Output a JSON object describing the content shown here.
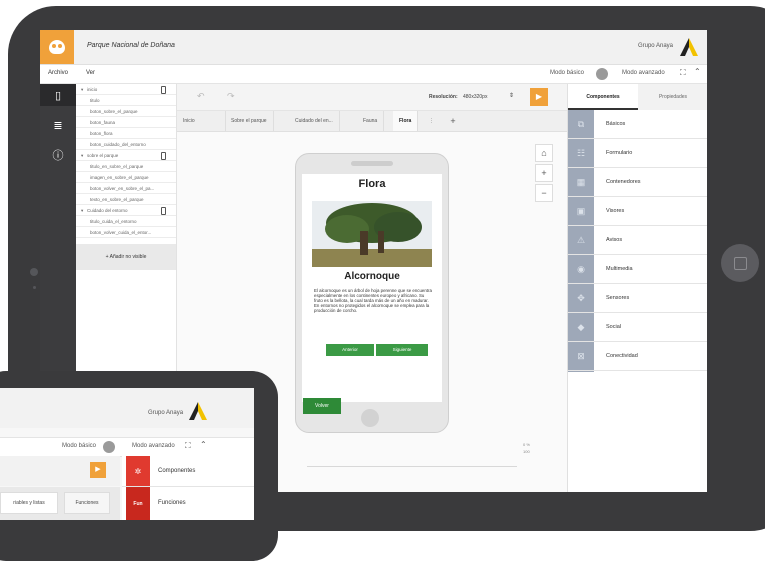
{
  "app": {
    "project_title": "Parque Nacional de Doñana",
    "brand": "Grupo Anaya",
    "brand_color": "#f0a13a"
  },
  "menu": {
    "archivo": "Archivo",
    "ver": "Ver",
    "mode_basic": "Modo básico",
    "mode_advanced": "Modo avanzado"
  },
  "left_nav": {
    "icons": [
      "phone-icon",
      "list-icon",
      "info-icon"
    ]
  },
  "tree": {
    "items": [
      "inicio",
      "titulo",
      "boton_sobre_el_parque",
      "boton_fauna",
      "boton_flora",
      "boton_cuidado_del_entorno",
      "sobre el parque",
      "titulo_en_sobre_el_parque",
      "imagen_en_sobre_el_parque",
      "boton_volver_en_sobre_el_pa...",
      "texto_en_sobre_el_parque",
      "Cuidado del entorno",
      "titulo_cuida_el_entorno",
      "boton_volver_cuida_el_entor..."
    ],
    "add_button": "+ Añadir no visible"
  },
  "canvas": {
    "resolution_label": "Resolución:",
    "resolution_value": "480x320px",
    "tabs": [
      "Inicio",
      "Sobre el parque",
      "Cuidado del en...",
      "Fauna",
      "Flora"
    ],
    "active_tab": "Flora",
    "tab_add": "+",
    "zoom_buttons": [
      "⌂",
      "+",
      "−"
    ],
    "slider_pct": "0 %",
    "slider_max": "100"
  },
  "phone_preview": {
    "title": "Flora",
    "subtitle": "Alcornoque",
    "text": "El alcornoque es un árbol de hoja perenne que se encuentra especialmente en los continentes europeo y africano. Su fruto es la bellota, la cual tarda más de un año en madurar. En entornos no protegidos el alcornoque se emplea para la producción de corcho.",
    "btn_prev": "Anterior",
    "btn_next": "Siguiente",
    "btn_back": "Volver"
  },
  "right_panel": {
    "tabs": [
      "Componentes",
      "Propiedades"
    ],
    "items": [
      {
        "label": "Básicos",
        "icon": "basic-icon"
      },
      {
        "label": "Formulario",
        "icon": "form-icon"
      },
      {
        "label": "Contenedores",
        "icon": "container-icon"
      },
      {
        "label": "Visores",
        "icon": "viewer-icon"
      },
      {
        "label": "Avisos",
        "icon": "alert-icon"
      },
      {
        "label": "Multimedia",
        "icon": "camera-icon"
      },
      {
        "label": "Sensores",
        "icon": "sensor-icon"
      },
      {
        "label": "Social",
        "icon": "social-icon"
      },
      {
        "label": "Conectividad",
        "icon": "connectivity-icon"
      }
    ]
  },
  "small_tablet": {
    "brand": "Grupo Anaya",
    "mode_basic": "Modo básico",
    "mode_advanced": "Modo avanzado",
    "components": "Componentes",
    "functions": "Funciones",
    "fun_badge": "Fun",
    "tab_vars": "riables y listas",
    "tab_funcs": "Funciones"
  }
}
